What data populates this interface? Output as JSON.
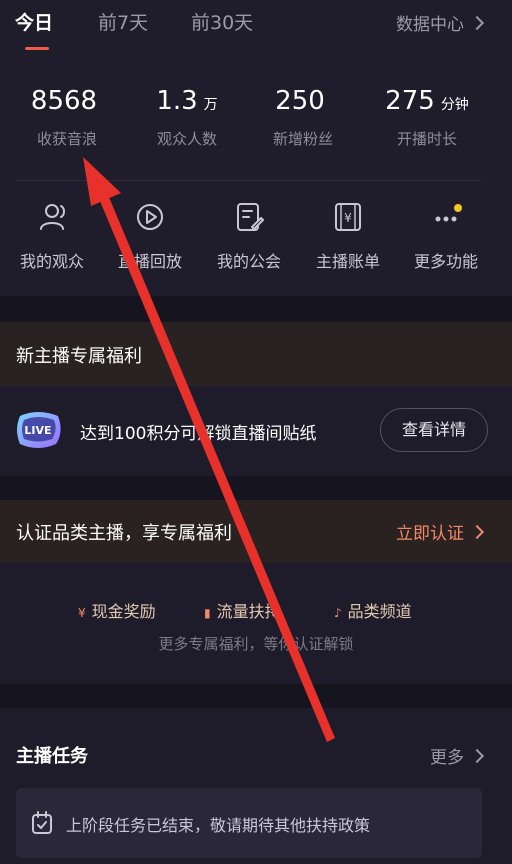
{
  "tabs": [
    {
      "label": "今日",
      "active": true
    },
    {
      "label": "前7天",
      "active": false
    },
    {
      "label": "前30天",
      "active": false
    }
  ],
  "data_center": {
    "label": "数据中心"
  },
  "stats": [
    {
      "value": "8568",
      "unit": "",
      "label": "收获音浪"
    },
    {
      "value": "1.3",
      "unit": "万",
      "label": "观众人数"
    },
    {
      "value": "250",
      "unit": "",
      "label": "新增粉丝"
    },
    {
      "value": "275",
      "unit": "分钟",
      "label": "开播时长"
    }
  ],
  "functions": [
    {
      "label": "我的观众",
      "icon": "users-icon"
    },
    {
      "label": "直播回放",
      "icon": "play-circle-icon"
    },
    {
      "label": "我的公会",
      "icon": "edit-document-icon"
    },
    {
      "label": "主播账单",
      "icon": "yen-card-icon"
    },
    {
      "label": "更多功能",
      "icon": "more-dots-icon",
      "badge": true
    }
  ],
  "welfare": {
    "title": "新主播专属福利",
    "badge_text": "LIVE",
    "text": "达到100积分可解锁直播间贴纸",
    "button": "查看详情"
  },
  "certification": {
    "title": "认证品类主播，享专属福利",
    "link": "立即认证",
    "perks": [
      {
        "icon": "¥",
        "label": "现金奖励"
      },
      {
        "icon": "▮",
        "label": "流量扶持"
      },
      {
        "icon": "♪",
        "label": "品类频道"
      }
    ],
    "subtitle": "更多专属福利，等你认证解锁"
  },
  "tasks": {
    "title": "主播任务",
    "more": "更多",
    "message": "上阶段任务已结束，敬请期待其他扶持政策"
  },
  "colors": {
    "background": "#15141f",
    "card": "#1f1d2c",
    "accent_red": "#f45a4d",
    "accent_orange": "#f3876a",
    "dot_yellow": "#f5c623",
    "arrow_red": "#e8312a"
  }
}
